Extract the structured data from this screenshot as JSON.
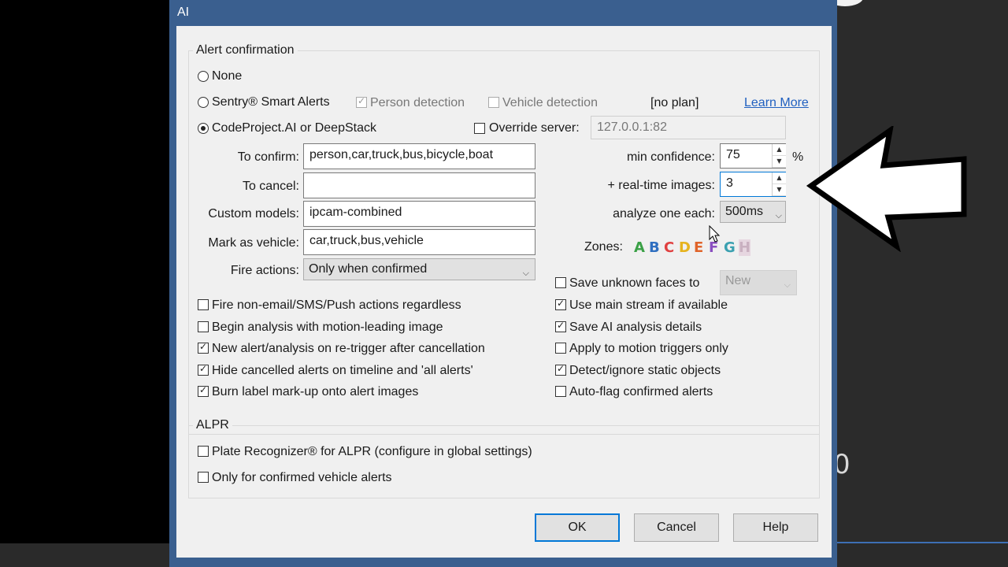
{
  "window": {
    "title": "AI"
  },
  "alert_confirmation": {
    "group_label": "Alert confirmation",
    "radio_none": "None",
    "radio_sentry": "Sentry® Smart Alerts",
    "person_detection": "Person detection",
    "vehicle_detection": "Vehicle detection",
    "no_plan": "[no plan]",
    "learn_more": "Learn More",
    "radio_codeproject": "CodeProject.AI or DeepStack",
    "override_server": "Override server:",
    "server_value": "127.0.0.1:82",
    "to_confirm_label": "To confirm:",
    "to_confirm_value": "person,car,truck,bus,bicycle,boat",
    "to_cancel_label": "To cancel:",
    "to_cancel_value": "",
    "custom_models_label": "Custom models:",
    "custom_models_value": "ipcam-combined",
    "mark_vehicle_label": "Mark as vehicle:",
    "mark_vehicle_value": "car,truck,bus,vehicle",
    "fire_actions_label": "Fire actions:",
    "fire_actions_value": "Only when confirmed",
    "min_confidence_label": "min confidence:",
    "min_confidence_value": "75",
    "percent": "%",
    "realtime_label": "+ real-time images:",
    "realtime_value": "3",
    "analyze_label": "analyze one each:",
    "analyze_value": "500ms",
    "zones_label": "Zones:",
    "zones": [
      {
        "letter": "A",
        "color": "#3aa046"
      },
      {
        "letter": "B",
        "color": "#2f6fc0"
      },
      {
        "letter": "C",
        "color": "#e04040"
      },
      {
        "letter": "D",
        "color": "#e6b31e"
      },
      {
        "letter": "E",
        "color": "#e0642a"
      },
      {
        "letter": "F",
        "color": "#8a4fc0"
      },
      {
        "letter": "G",
        "color": "#3aa0b0"
      },
      {
        "letter": "H",
        "color": "#c9b0c0"
      }
    ],
    "left_checks": [
      {
        "label": "Fire non-email/SMS/Push actions regardless",
        "checked": false
      },
      {
        "label": "Begin analysis with motion-leading image",
        "checked": false
      },
      {
        "label": "New alert/analysis on re-trigger after cancellation",
        "checked": true
      },
      {
        "label": "Hide cancelled alerts on timeline and  'all alerts'",
        "checked": true
      },
      {
        "label": "Burn label mark-up onto alert images",
        "checked": true
      }
    ],
    "save_unknown_faces": "Save unknown faces to",
    "faces_select_value": "New",
    "right_checks": [
      {
        "label": "Use main stream if available",
        "checked": true
      },
      {
        "label": "Save AI analysis details",
        "checked": true
      },
      {
        "label": "Apply to motion triggers only",
        "checked": false
      },
      {
        "label": "Detect/ignore static objects",
        "checked": true
      },
      {
        "label": "Auto-flag confirmed alerts",
        "checked": false
      }
    ]
  },
  "alpr": {
    "group_label": "ALPR",
    "plate_recognizer": "Plate Recognizer® for ALPR (configure in global settings)",
    "only_vehicle": "Only for confirmed vehicle alerts"
  },
  "buttons": {
    "ok": "OK",
    "cancel": "Cancel",
    "help": "Help"
  },
  "background": {
    "partial_text": "0"
  }
}
